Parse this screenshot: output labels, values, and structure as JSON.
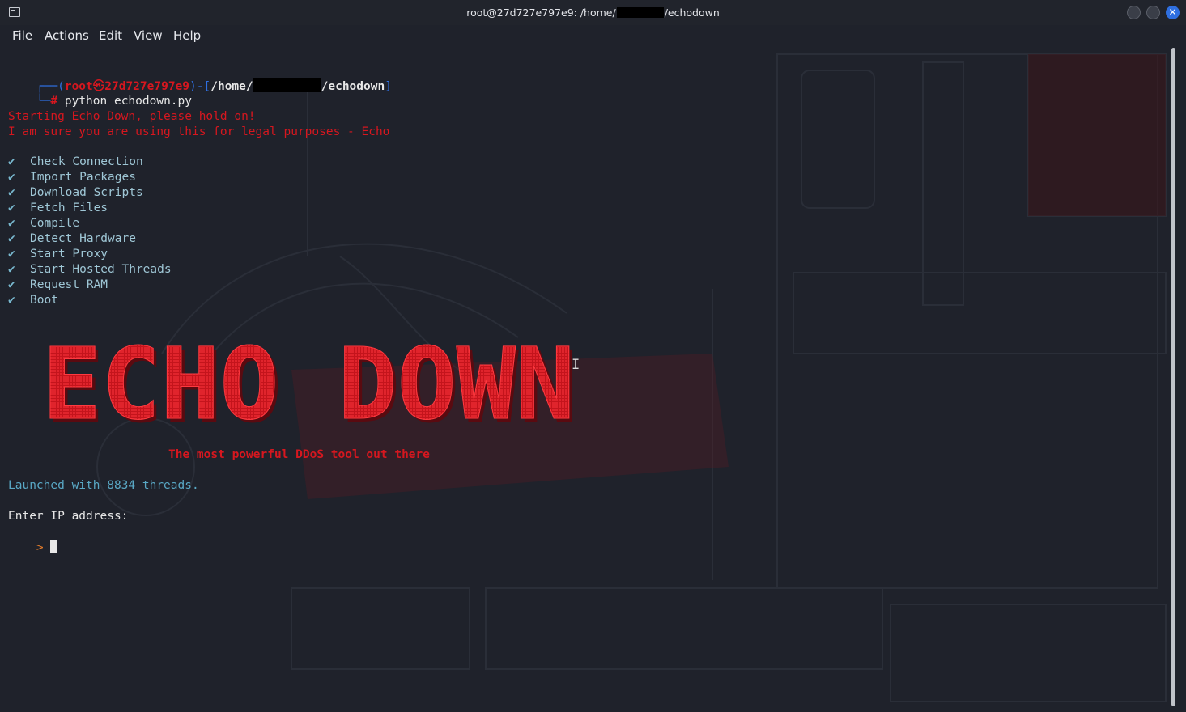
{
  "window": {
    "title_prefix": "root@27d727e797e9: /home/",
    "title_suffix": "/echodown",
    "close_glyph": "✕"
  },
  "menu": [
    "File",
    "Actions",
    "Edit",
    "View",
    "Help"
  ],
  "prompt": {
    "user": "root",
    "at_glyph": "㉿",
    "host": "27d727e797e9",
    "path_prefix": "/home/",
    "path_suffix": "/echodown",
    "hash": "#",
    "command": "python echodown.py"
  },
  "output": {
    "start_line1": "Starting Echo Down, please hold on!",
    "start_line2": "I am sure you are using this for legal purposes - Echo",
    "check_glyph": "✔",
    "checks": [
      "Check Connection",
      "Import Packages",
      "Download Scripts",
      "Fetch Files",
      "Compile",
      "Detect Hardware",
      "Start Proxy",
      "Start Hosted Threads",
      "Request RAM",
      "Boot"
    ],
    "banner": "ECHO DOWN",
    "tagline": "The most powerful DDoS tool out there",
    "launched": "Launched with 8834 threads.",
    "input_label": "Enter IP address:",
    "input_prompt": ">"
  },
  "colors": {
    "accent_red": "#d6171f",
    "prompt_blue": "#2f6fe0",
    "check_teal": "#9fc7d6"
  }
}
